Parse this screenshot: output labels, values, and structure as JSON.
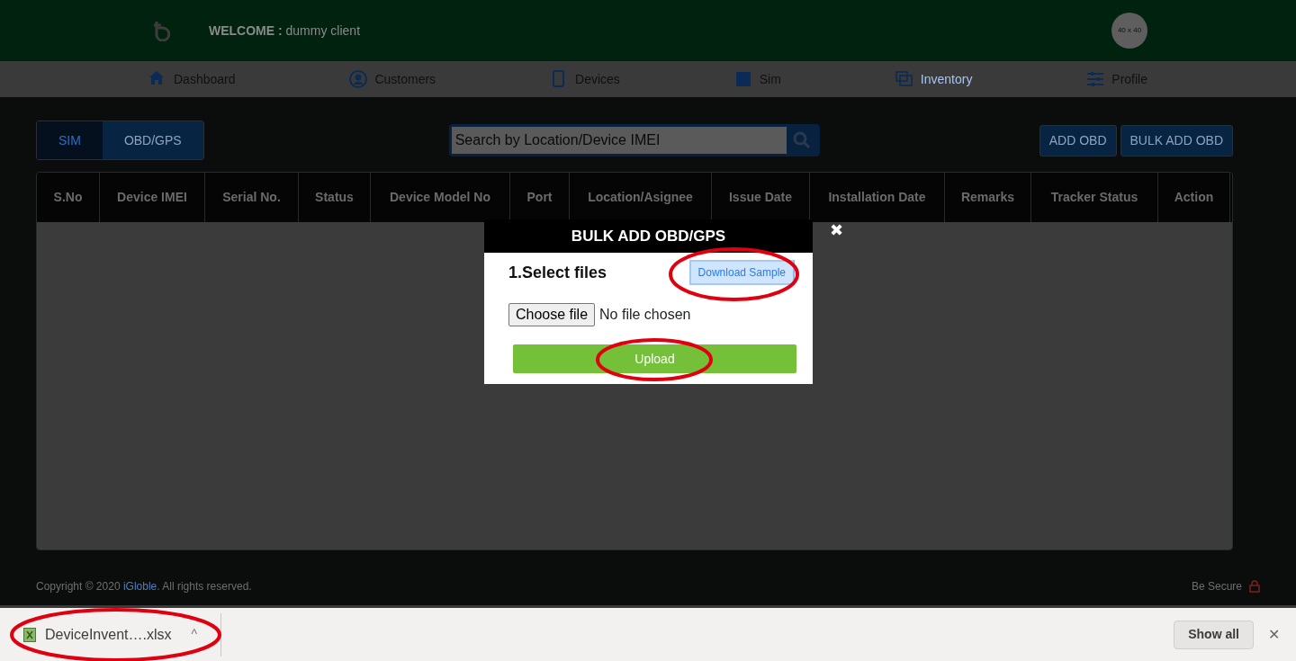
{
  "header": {
    "welcome_label": "WELCOME :",
    "welcome_name": "dummy client",
    "avatar_text": "40 x 40"
  },
  "nav": [
    {
      "label": "Dashboard",
      "selected": false
    },
    {
      "label": "Customers",
      "selected": false
    },
    {
      "label": "Devices",
      "selected": false
    },
    {
      "label": "Sim",
      "selected": false
    },
    {
      "label": "Inventory",
      "selected": true
    },
    {
      "label": "Profile",
      "selected": false
    }
  ],
  "toggle": [
    {
      "label": "SIM",
      "selected": false
    },
    {
      "label": "OBD/GPS",
      "selected": true
    }
  ],
  "search": {
    "placeholder": "Search by Location/Device IMEI"
  },
  "actions": [
    "ADD OBD",
    "BULK ADD OBD"
  ],
  "table": {
    "columns": [
      "S.No",
      "Device IMEI",
      "Serial No.",
      "Status",
      "Device Model No",
      "Port",
      "Location/Asignee",
      "Issue Date",
      "Installation Date",
      "Remarks",
      "Tracker Status",
      "Action"
    ]
  },
  "footer": {
    "copyright_before": "Copyright © 2020 ",
    "brand": "iGloble",
    "copyright_after": ". All rights reserved.",
    "secure": "Be Secure"
  },
  "modal": {
    "title": "BULK ADD OBD/GPS",
    "step": "1.Select files",
    "download_button": "Download Sample",
    "choose_button": "Choose file",
    "file_status": "No file chosen",
    "upload_button": "Upload",
    "close": "✖"
  },
  "download_bar": {
    "file": "DeviceInvent….xlsx",
    "caret": "^",
    "show_all": "Show all",
    "close": "✕"
  }
}
